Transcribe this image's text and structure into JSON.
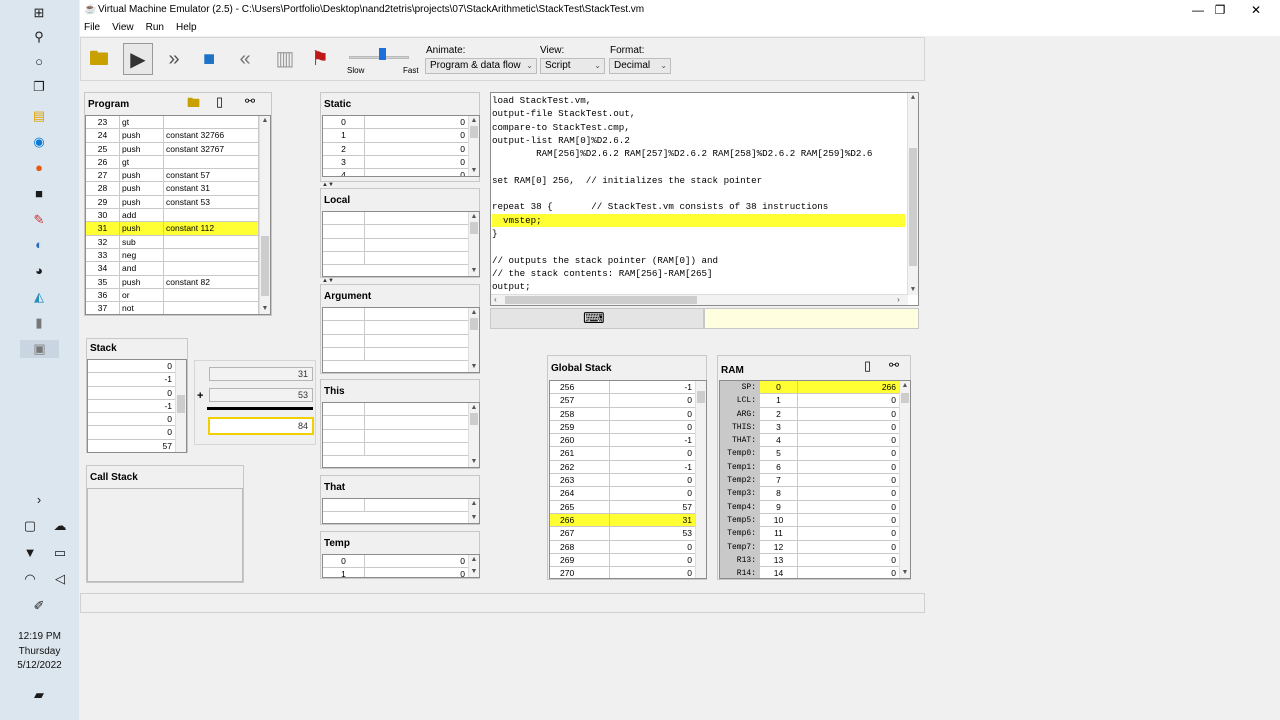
{
  "window": {
    "title": "Virtual Machine Emulator (2.5) - C:\\Users\\Portfolio\\Desktop\\nand2tetris\\projects\\07\\StackArithmetic\\StackTest\\StackTest.vm"
  },
  "menu": [
    "File",
    "View",
    "Run",
    "Help"
  ],
  "toolbar": {
    "speed_slow": "Slow",
    "speed_fast": "Fast",
    "animate_label": "Animate:",
    "animate_value": "Program & data flow",
    "view_label": "View:",
    "view_value": "Script",
    "format_label": "Format:",
    "format_value": "Decimal"
  },
  "program": {
    "title": "Program",
    "rows": [
      {
        "n": "23",
        "op": "gt",
        "arg": ""
      },
      {
        "n": "24",
        "op": "push",
        "arg": "constant 32766"
      },
      {
        "n": "25",
        "op": "push",
        "arg": "constant 32767"
      },
      {
        "n": "26",
        "op": "gt",
        "arg": ""
      },
      {
        "n": "27",
        "op": "push",
        "arg": "constant 57"
      },
      {
        "n": "28",
        "op": "push",
        "arg": "constant 31"
      },
      {
        "n": "29",
        "op": "push",
        "arg": "constant 53"
      },
      {
        "n": "30",
        "op": "add",
        "arg": ""
      },
      {
        "n": "31",
        "op": "push",
        "arg": "constant 112",
        "hl": true
      },
      {
        "n": "32",
        "op": "sub",
        "arg": ""
      },
      {
        "n": "33",
        "op": "neg",
        "arg": ""
      },
      {
        "n": "34",
        "op": "and",
        "arg": ""
      },
      {
        "n": "35",
        "op": "push",
        "arg": "constant 82"
      },
      {
        "n": "36",
        "op": "or",
        "arg": ""
      },
      {
        "n": "37",
        "op": "not",
        "arg": ""
      }
    ]
  },
  "stack": {
    "title": "Stack",
    "values": [
      "0",
      "-1",
      "0",
      "-1",
      "0",
      "0",
      "57"
    ]
  },
  "alu": {
    "op1": "31",
    "op2": "53",
    "operator": "+",
    "result": "84"
  },
  "call_stack": {
    "title": "Call Stack"
  },
  "static": {
    "title": "Static",
    "rows": [
      {
        "i": "0",
        "v": "0"
      },
      {
        "i": "1",
        "v": "0"
      },
      {
        "i": "2",
        "v": "0"
      },
      {
        "i": "3",
        "v": "0"
      },
      {
        "i": "4",
        "v": "0"
      }
    ]
  },
  "local": {
    "title": "Local"
  },
  "argument": {
    "title": "Argument"
  },
  "this_seg": {
    "title": "This"
  },
  "that_seg": {
    "title": "That"
  },
  "temp": {
    "title": "Temp",
    "rows": [
      {
        "i": "0",
        "v": "0"
      },
      {
        "i": "1",
        "v": "0"
      }
    ]
  },
  "script": {
    "lines": [
      "load StackTest.vm,",
      "output-file StackTest.out,",
      "compare-to StackTest.cmp,",
      "output-list RAM[0]%D2.6.2",
      "        RAM[256]%D2.6.2 RAM[257]%D2.6.2 RAM[258]%D2.6.2 RAM[259]%D2.6",
      "",
      "set RAM[0] 256,  // initializes the stack pointer",
      "",
      "repeat 38 {       // StackTest.vm consists of 38 instructions",
      "  vmstep;",
      "}",
      "",
      "// outputs the stack pointer (RAM[0]) and",
      "// the stack contents: RAM[256]-RAM[265]",
      "output;"
    ],
    "highlight_index": 9
  },
  "global_stack": {
    "title": "Global Stack",
    "rows": [
      {
        "a": "256",
        "v": "-1"
      },
      {
        "a": "257",
        "v": "0"
      },
      {
        "a": "258",
        "v": "0"
      },
      {
        "a": "259",
        "v": "0"
      },
      {
        "a": "260",
        "v": "-1"
      },
      {
        "a": "261",
        "v": "0"
      },
      {
        "a": "262",
        "v": "-1"
      },
      {
        "a": "263",
        "v": "0"
      },
      {
        "a": "264",
        "v": "0"
      },
      {
        "a": "265",
        "v": "57"
      },
      {
        "a": "266",
        "v": "31",
        "hl": true
      },
      {
        "a": "267",
        "v": "53"
      },
      {
        "a": "268",
        "v": "0"
      },
      {
        "a": "269",
        "v": "0"
      },
      {
        "a": "270",
        "v": "0"
      }
    ]
  },
  "ram": {
    "title": "RAM",
    "rows": [
      {
        "label": "SP:",
        "a": "0",
        "v": "266",
        "hl": true
      },
      {
        "label": "LCL:",
        "a": "1",
        "v": "0"
      },
      {
        "label": "ARG:",
        "a": "2",
        "v": "0"
      },
      {
        "label": "THIS:",
        "a": "3",
        "v": "0"
      },
      {
        "label": "THAT:",
        "a": "4",
        "v": "0"
      },
      {
        "label": "Temp0:",
        "a": "5",
        "v": "0"
      },
      {
        "label": "Temp1:",
        "a": "6",
        "v": "0"
      },
      {
        "label": "Temp2:",
        "a": "7",
        "v": "0"
      },
      {
        "label": "Temp3:",
        "a": "8",
        "v": "0"
      },
      {
        "label": "Temp4:",
        "a": "9",
        "v": "0"
      },
      {
        "label": "Temp5:",
        "a": "10",
        "v": "0"
      },
      {
        "label": "Temp6:",
        "a": "11",
        "v": "0"
      },
      {
        "label": "Temp7:",
        "a": "12",
        "v": "0"
      },
      {
        "label": "R13:",
        "a": "13",
        "v": "0"
      },
      {
        "label": "R14:",
        "a": "14",
        "v": "0"
      }
    ]
  },
  "taskbar": {
    "time": "12:19 PM",
    "day": "Thursday",
    "date": "5/12/2022"
  },
  "colors": {
    "highlight": "#ffff33",
    "accent": "#1e6fd9"
  }
}
